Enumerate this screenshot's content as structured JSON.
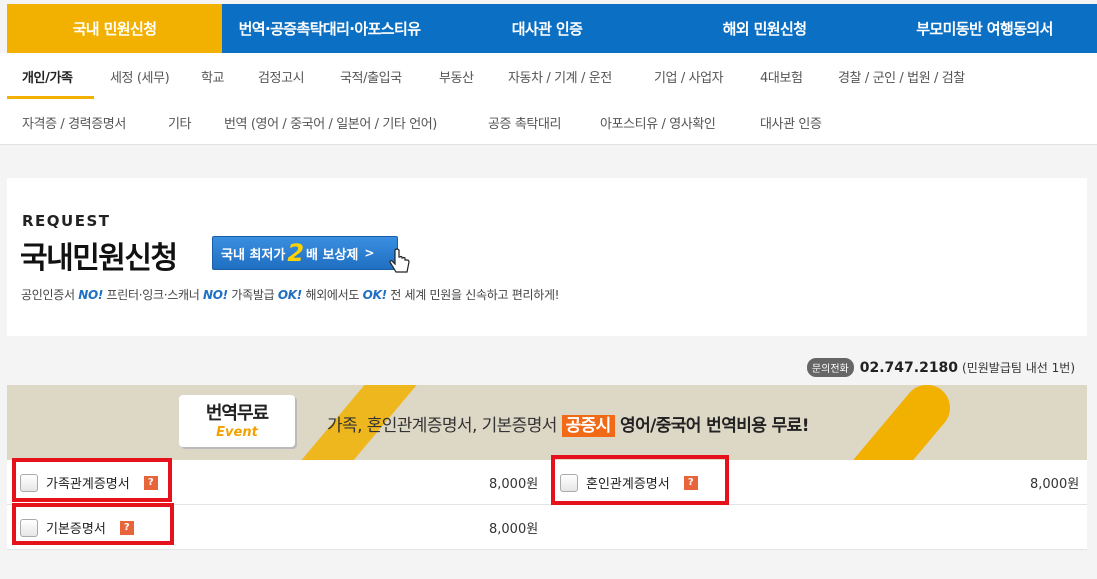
{
  "top_nav": [
    {
      "label": "국내 민원신청",
      "active": true
    },
    {
      "label": "번역·공증촉탁대리·아포스티유",
      "active": false
    },
    {
      "label": "대사관 인증",
      "active": false
    },
    {
      "label": "해외 민원신청",
      "active": false
    },
    {
      "label": "부모미동반 여행동의서",
      "active": false
    }
  ],
  "sub_nav": {
    "row1": [
      "개인/가족",
      "세정 (세무)",
      "학교",
      "검정고시",
      "국적/출입국",
      "부동산",
      "자동차 / 기계 / 운전",
      "기업 / 사업자",
      "4대보험",
      "경찰 / 군인 / 법원 / 검찰"
    ],
    "row2": [
      "자격증 / 경력증명서",
      "기타",
      "번역 (영어 / 중국어 / 일본어 / 기타 언어)",
      "공증 촉탁대리",
      "아포스티유 / 영사확인",
      "대사관 인증"
    ],
    "active": "개인/가족"
  },
  "request": {
    "eyebrow": "REQUEST",
    "title": "국내민원신청",
    "badge_pre": "국내 최저가",
    "badge_num": "2",
    "badge_post": "배 보상제",
    "badge_arrow": ">",
    "desc": [
      {
        "text": "공인인증서 ",
        "em": false
      },
      {
        "text": "NO!",
        "em": true
      },
      {
        "text": " 프린터·잉크·스캐너 ",
        "em": false
      },
      {
        "text": "NO!",
        "em": true
      },
      {
        "text": " 가족발급 ",
        "em": false
      },
      {
        "text": "OK!",
        "em": true
      },
      {
        "text": " 해외에서도 ",
        "em": false
      },
      {
        "text": "OK!",
        "em": true
      },
      {
        "text": " 전 세계 민원을 신속하고 편리하게!",
        "em": false
      }
    ]
  },
  "contact": {
    "tag": "문의전화",
    "number": "02.747.2180",
    "note": "(민원발급팀 내선 1번)"
  },
  "banner": {
    "box_title": "번역무료",
    "box_sub": "Event",
    "msg_pre": "가족, 혼인관계증명서, 기본증명서 ",
    "msg_hl": "공증시",
    "msg_post": " 영어/중국어 번역비용 무료!"
  },
  "documents": [
    {
      "name": "가족관계증명서",
      "price": "8,000원",
      "help": "?"
    },
    {
      "name": "혼인관계증명서",
      "price": "8,000원",
      "help": "?"
    },
    {
      "name": "기본증명서",
      "price": "8,000원",
      "help": "?"
    }
  ],
  "colors": {
    "nav_blue": "#0b6fc4",
    "nav_active": "#f2b100",
    "highlight_red": "#e5121c",
    "accent_orange": "#f26a16"
  }
}
